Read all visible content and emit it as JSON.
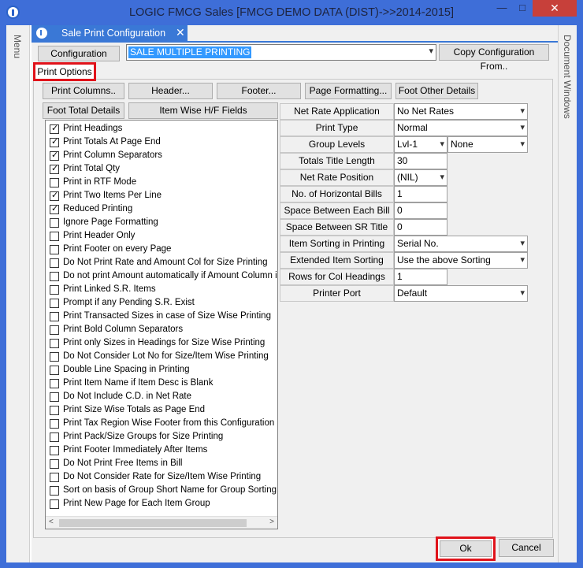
{
  "window": {
    "title": "LOGIC FMCG Sales  [FMCG DEMO DATA (DIST)->>2014-2015]",
    "controls": {
      "minimize": "—",
      "maximize": "□",
      "close": "✕"
    }
  },
  "side": {
    "menu": "Menu",
    "documents": "Document Windows"
  },
  "doc_tab": {
    "label": "Sale Print Configuration",
    "close": "✕"
  },
  "config": {
    "button": "Configuration",
    "selected": "SALE MULTIPLE PRINTING",
    "copy_button": "Copy  Configuration From.."
  },
  "active_tab": "Print Options",
  "toolbar": {
    "print_columns": "Print Columns..",
    "header": "Header...",
    "footer": "Footer...",
    "page_formatting": "Page Formatting...",
    "foot_other_details": "Foot Other Details",
    "foot_total_details": "Foot Total Details",
    "item_wise_hf": "Item Wise H/F Fields"
  },
  "options": [
    {
      "label": "Print Headings",
      "checked": true
    },
    {
      "label": "Print Totals At Page End",
      "checked": true
    },
    {
      "label": "Print Column Separators",
      "checked": true
    },
    {
      "label": "Print Total Qty",
      "checked": true
    },
    {
      "label": "Print in RTF Mode",
      "checked": false
    },
    {
      "label": "Print Two Items Per Line",
      "checked": true
    },
    {
      "label": "Reduced Printing",
      "checked": true
    },
    {
      "label": "Ignore Page Formatting",
      "checked": false
    },
    {
      "label": "Print Header Only",
      "checked": false
    },
    {
      "label": "Print Footer on every Page",
      "checked": false
    },
    {
      "label": "Do Not Print Rate and Amount Col for Size Printing",
      "checked": false
    },
    {
      "label": "Do not print Amount automatically if Amount Column is not",
      "checked": false
    },
    {
      "label": "Print Linked S.R. Items",
      "checked": false
    },
    {
      "label": "Prompt if any Pending S.R. Exist",
      "checked": false
    },
    {
      "label": "Print Transacted Sizes in case of Size Wise Printing",
      "checked": false
    },
    {
      "label": "Print Bold Column Separators",
      "checked": false
    },
    {
      "label": "Print only Sizes in Headings for Size Wise Printing",
      "checked": false
    },
    {
      "label": "Do Not Consider Lot No for Size/Item Wise Printing",
      "checked": false
    },
    {
      "label": "Double Line Spacing in Printing",
      "checked": false
    },
    {
      "label": "Print Item Name if Item Desc is Blank",
      "checked": false
    },
    {
      "label": "Do Not Include C.D. in Net Rate",
      "checked": false
    },
    {
      "label": "Print Size Wise Totals as Page End",
      "checked": false
    },
    {
      "label": "Print Tax Region Wise Footer from this Configuration",
      "checked": false
    },
    {
      "label": "Print Pack/Size Groups for Size Printing",
      "checked": false
    },
    {
      "label": "Print Footer Immediately After Items",
      "checked": false
    },
    {
      "label": "Do Not Print Free Items in Bill",
      "checked": false
    },
    {
      "label": "Do Not Consider Rate for Size/Item Wise Printing",
      "checked": false
    },
    {
      "label": "Sort on basis of Group Short Name for Group Sorting",
      "checked": false
    },
    {
      "label": "Print New Page for Each Item Group",
      "checked": false
    }
  ],
  "settings": {
    "net_rate_application": {
      "label": "Net Rate Application",
      "value": "No Net Rates"
    },
    "print_type": {
      "label": "Print Type",
      "value": "Normal"
    },
    "group_levels": {
      "label": "Group Levels",
      "value": "Lvl-1",
      "value2": "None"
    },
    "totals_title_length": {
      "label": "Totals Title Length",
      "value": "30"
    },
    "net_rate_position": {
      "label": "Net Rate Position",
      "value": "(NIL)"
    },
    "horizontal_bills": {
      "label": "No. of Horizontal Bills",
      "value": "1"
    },
    "space_each_bill": {
      "label": "Space Between Each Bill",
      "value": "0"
    },
    "space_sr_title": {
      "label": "Space Between SR Title",
      "value": "0"
    },
    "item_sorting": {
      "label": "Item Sorting in Printing",
      "value": "Serial No."
    },
    "extended_sorting": {
      "label": "Extended Item Sorting",
      "value": "Use the above Sorting"
    },
    "rows_col_headings": {
      "label": "Rows for Col Headings",
      "value": "1"
    },
    "printer_port": {
      "label": "Printer Port",
      "value": "Default"
    }
  },
  "footer": {
    "ok": "Ok",
    "cancel": "Cancel"
  }
}
